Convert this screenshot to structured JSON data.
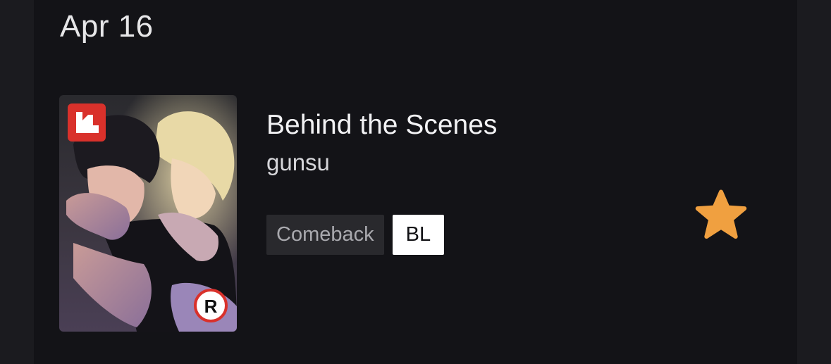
{
  "date_heading": "Apr 16",
  "item": {
    "title": "Behind the Scenes",
    "author": "gunsu",
    "tags": [
      "Comeback",
      "BL"
    ],
    "rating_badge": "R",
    "logo_icon": "lezhin-logo-icon",
    "favorite_icon": "star-icon",
    "favorite_color": "#f0a040",
    "logo_color": "#d9312b"
  }
}
